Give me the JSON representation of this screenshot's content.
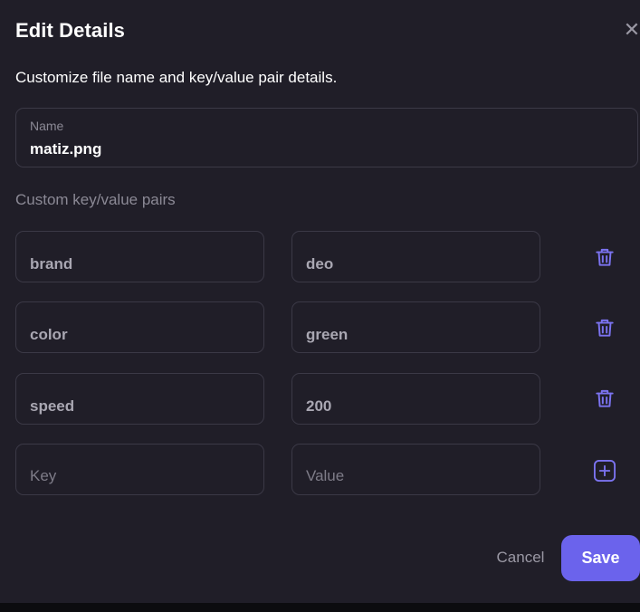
{
  "dialog": {
    "title": "Edit Details",
    "close_icon": "close-icon",
    "subtitle": "Customize file name and key/value pair details."
  },
  "name_field": {
    "label": "Name",
    "value": "matiz.png"
  },
  "custom_pairs": {
    "label": "Custom key/value pairs",
    "rows": [
      {
        "key": "brand",
        "value": "deo",
        "icon": "trash-icon"
      },
      {
        "key": "color",
        "value": "green",
        "icon": "trash-icon"
      },
      {
        "key": "speed",
        "value": "200",
        "icon": "trash-icon"
      }
    ],
    "new_row": {
      "key_placeholder": "Key",
      "value_placeholder": "Value",
      "icon": "plus-square-icon"
    }
  },
  "footer": {
    "cancel_label": "Cancel",
    "save_label": "Save"
  },
  "colors": {
    "background": "#201e28",
    "border": "#3b3946",
    "accent": "#6b63ec",
    "icon": "#7b73f0"
  }
}
